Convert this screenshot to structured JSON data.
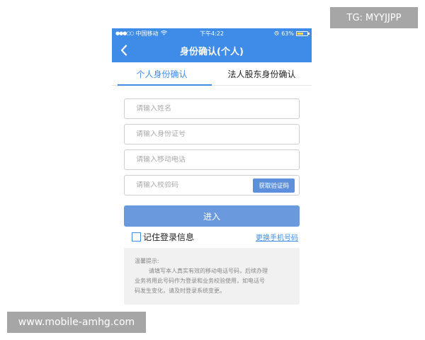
{
  "status_bar": {
    "signal_dots": "●●●○○",
    "carrier": "中国移动",
    "time": "下午4:22",
    "battery_percent": "63%",
    "battery_level": 0.63
  },
  "nav": {
    "title": "身份确认(个人)"
  },
  "tabs": [
    {
      "label": "个人身份确认",
      "active": true
    },
    {
      "label": "法人股东身份确认",
      "active": false
    }
  ],
  "form": {
    "name_placeholder": "请输入姓名",
    "id_placeholder": "请输入身份证号",
    "phone_placeholder": "请输入移动电话",
    "code_placeholder": "请输入校验码",
    "get_code_label": "获取验证码",
    "submit_label": "进入",
    "remember_label": "记住登录信息",
    "change_phone_label": "更换手机号码"
  },
  "notice": {
    "title": "温馨提示:",
    "line1": "请填写本人真实有效的移动电话号码，后续办理",
    "line2": "业务将用此号码作为登录和业务校验使用，如电话号",
    "line3": "码发生变化，请及时登录系统变更。"
  },
  "watermarks": {
    "tg": "TG: MYYJJPP",
    "site": "www.mobile-amhg.com"
  },
  "colors": {
    "primary": "#3f8ce8",
    "button": "#6b99dd",
    "code_button": "#5d8fdc",
    "battery": "#ffd84a"
  }
}
